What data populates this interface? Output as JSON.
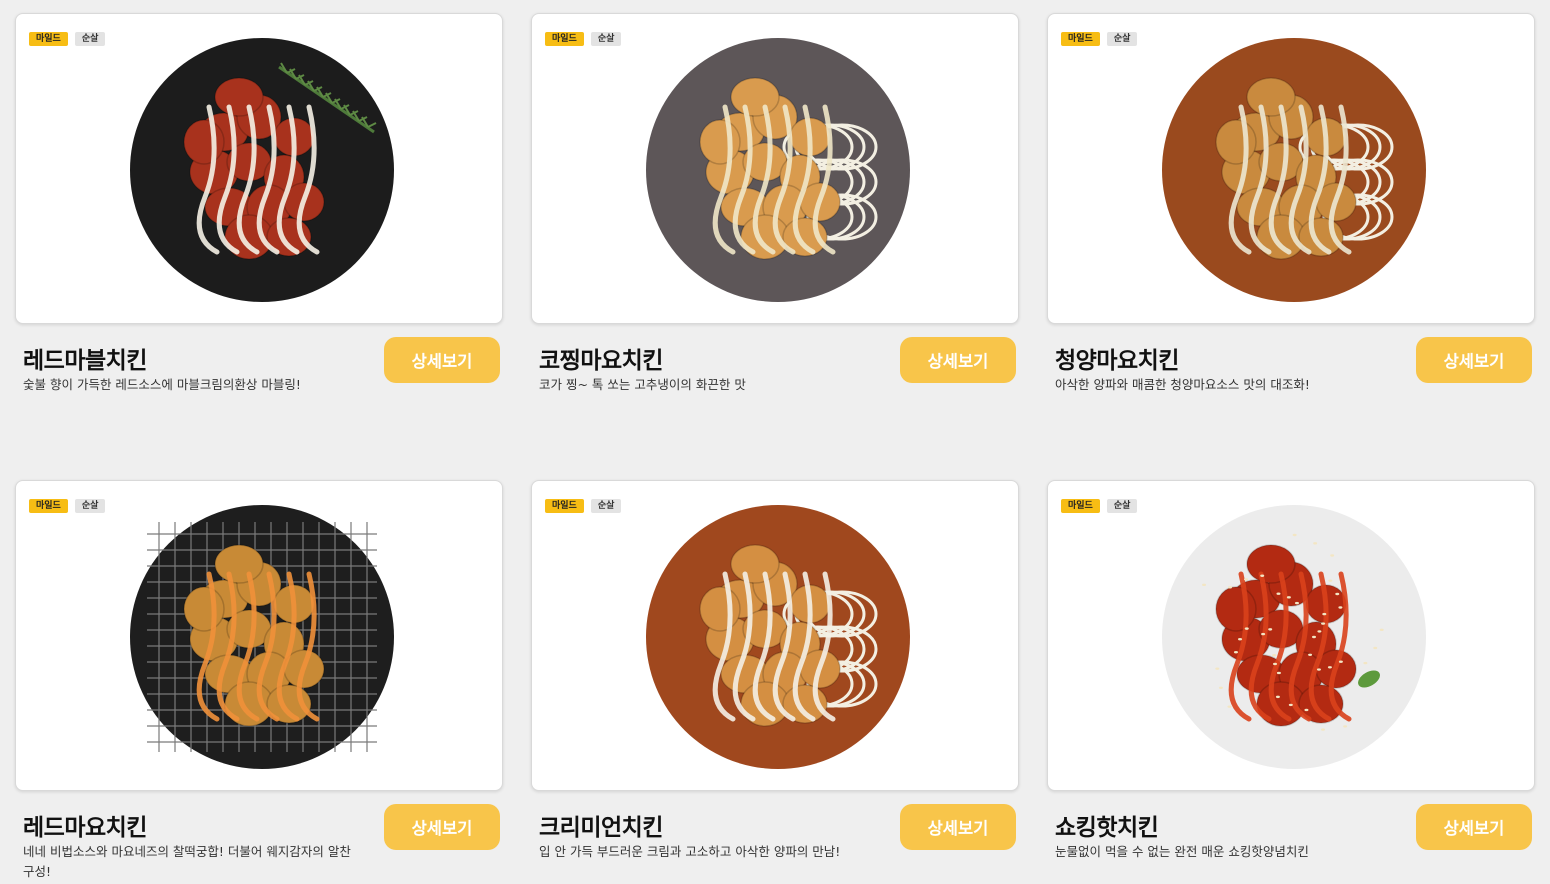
{
  "menu": [
    {
      "name": "레드마블치킨",
      "description": "숯불 향이 가득한 레드소스에 마블크림의환상 마블링!",
      "tags": [
        "마일드",
        "순살"
      ],
      "button_label": "상세보기",
      "plate_color": "#1c1c1c",
      "food_color": "#a8321d",
      "sauce_color": "#f5f1e6",
      "garnish": "rosemary"
    },
    {
      "name": "코찡마요치킨",
      "description": "코가 찡~ 톡 쏘는 고추냉이의 화끈한 맛",
      "tags": [
        "마일드",
        "순살"
      ],
      "button_label": "상세보기",
      "plate_color": "#5d5658",
      "food_color": "#d99b4e",
      "sauce_color": "#efe7c8",
      "garnish": "onion"
    },
    {
      "name": "청양마요치킨",
      "description": "아삭한 양파와 매콤한 청양마요소스 맛의 대조화!",
      "tags": [
        "마일드",
        "순살"
      ],
      "button_label": "상세보기",
      "plate_color": "#9a4a1e",
      "food_color": "#c98a3e",
      "sauce_color": "#ece7d2",
      "garnish": "onion"
    },
    {
      "name": "레드마요치킨",
      "description": "네네 비법소스와 마요네즈의 찰떡궁합! 더불어 웨지감자의 알찬구성!",
      "tags": [
        "마일드",
        "순살"
      ],
      "button_label": "상세보기",
      "plate_color": "#1e1e1e",
      "food_color": "#c88a36",
      "sauce_color": "#f0903a",
      "garnish": "grill"
    },
    {
      "name": "크리미언치킨",
      "description": "입 안 가득 부드러운 크림과 고소하고 아삭한 양파의 만남!",
      "tags": [
        "마일드",
        "순살"
      ],
      "button_label": "상세보기",
      "plate_color": "#a0481e",
      "food_color": "#d48f42",
      "sauce_color": "#f4f0e6",
      "garnish": "onion"
    },
    {
      "name": "쇼킹핫치킨",
      "description": "눈물없이 먹을 수 없는 완전 매운 쇼킹핫양념치킨",
      "tags": [
        "마일드",
        "순살"
      ],
      "button_label": "상세보기",
      "plate_color": "#ececec",
      "food_color": "#b32a12",
      "sauce_color": "#d9411c",
      "garnish": "sesame"
    }
  ]
}
